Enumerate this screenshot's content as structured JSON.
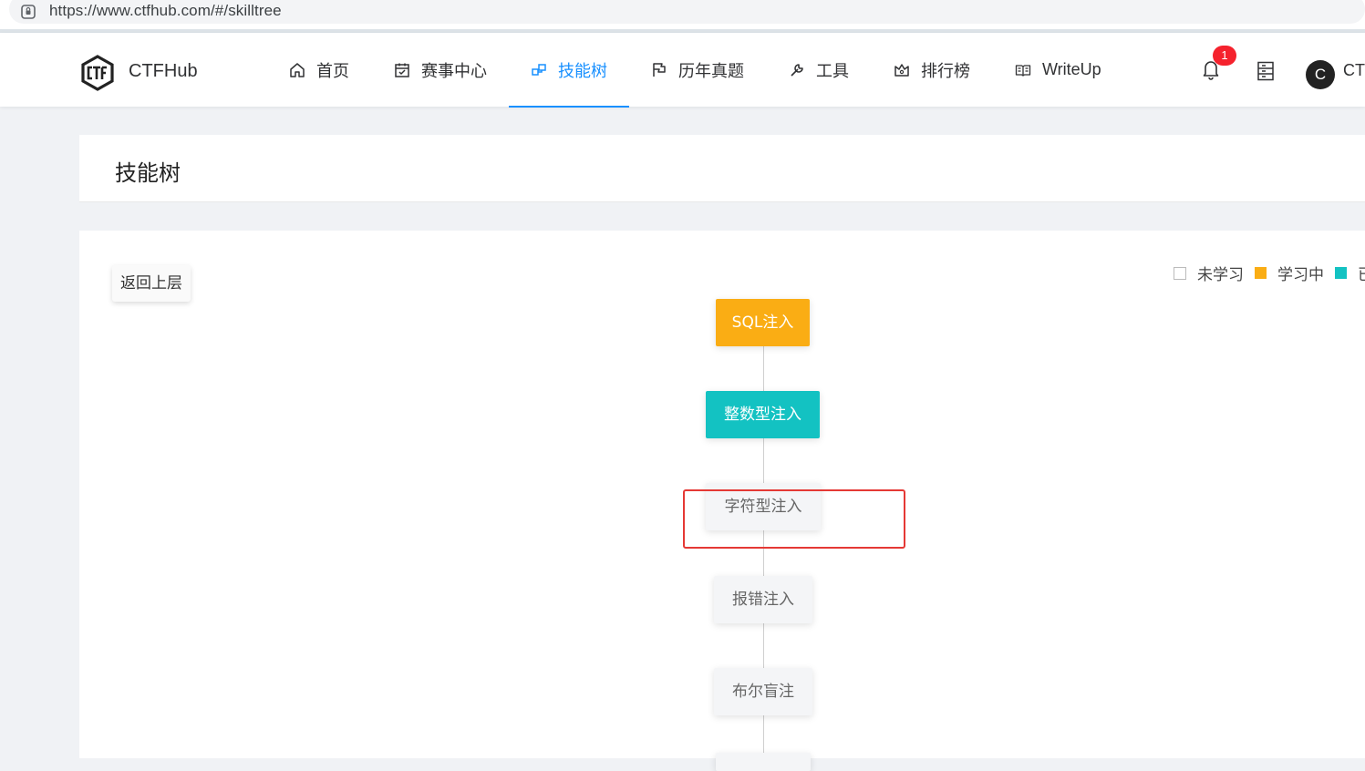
{
  "browser": {
    "url": "https://www.ctfhub.com/#/skilltree"
  },
  "header": {
    "brand": "CTFHub",
    "nav": [
      {
        "label": "首页",
        "icon": "home-icon"
      },
      {
        "label": "赛事中心",
        "icon": "calendar-icon"
      },
      {
        "label": "技能树",
        "icon": "skilltree-icon",
        "active": true
      },
      {
        "label": "历年真题",
        "icon": "flag-icon"
      },
      {
        "label": "工具",
        "icon": "wrench-icon"
      },
      {
        "label": "排行榜",
        "icon": "trophy-icon"
      },
      {
        "label": "WriteUp",
        "icon": "book-icon"
      }
    ],
    "notification_count": "1",
    "avatar_initial": "C",
    "username": "CTF"
  },
  "page": {
    "title": "技能树"
  },
  "tree": {
    "back_label": "返回上层",
    "legend": [
      {
        "label": "未学习",
        "color": "#ffffff"
      },
      {
        "label": "学习中",
        "color": "#faad14"
      },
      {
        "label": "已完成",
        "color": "#13c2c2"
      }
    ],
    "nodes": [
      {
        "label": "SQL注入",
        "status": "learning"
      },
      {
        "label": "整数型注入",
        "status": "done"
      },
      {
        "label": "字符型注入",
        "status": "todo"
      },
      {
        "label": "报错注入",
        "status": "todo"
      },
      {
        "label": "布尔盲注",
        "status": "todo"
      }
    ]
  },
  "colors": {
    "accent": "#1890ff",
    "learning": "#faad14",
    "done": "#13c2c2",
    "badge": "#f5222d",
    "highlight": "#e53935"
  }
}
